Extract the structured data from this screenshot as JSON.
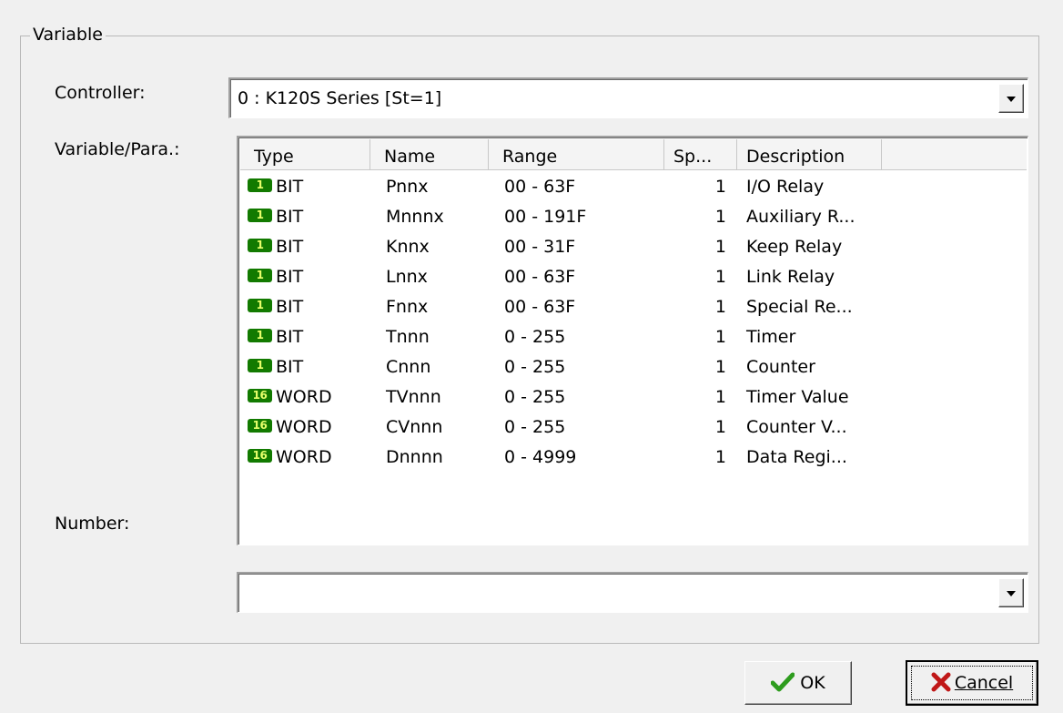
{
  "group": {
    "title": "Variable"
  },
  "labels": {
    "controller": "Controller:",
    "variable_para": "Variable/Para.:",
    "number": "Number:"
  },
  "controller_combo": {
    "value": "0 : K120S Series [St=1]"
  },
  "number_combo": {
    "value": ""
  },
  "table": {
    "columns": [
      "Type",
      "Name",
      "Range",
      "Sp...",
      "Description"
    ],
    "rows": [
      {
        "badge": "1",
        "type": "BIT",
        "name": "Pnnx",
        "range": "00 - 63F",
        "sp": "1",
        "desc": "I/O Relay"
      },
      {
        "badge": "1",
        "type": "BIT",
        "name": "Mnnnx",
        "range": "00 - 191F",
        "sp": "1",
        "desc": "Auxiliary R..."
      },
      {
        "badge": "1",
        "type": "BIT",
        "name": "Knnx",
        "range": "00 - 31F",
        "sp": "1",
        "desc": "Keep Relay"
      },
      {
        "badge": "1",
        "type": "BIT",
        "name": "Lnnx",
        "range": "00 - 63F",
        "sp": "1",
        "desc": "Link Relay"
      },
      {
        "badge": "1",
        "type": "BIT",
        "name": "Fnnx",
        "range": "00 - 63F",
        "sp": "1",
        "desc": "Special Re..."
      },
      {
        "badge": "1",
        "type": "BIT",
        "name": "Tnnn",
        "range": "0 - 255",
        "sp": "1",
        "desc": "Timer"
      },
      {
        "badge": "1",
        "type": "BIT",
        "name": "Cnnn",
        "range": "0 - 255",
        "sp": "1",
        "desc": "Counter"
      },
      {
        "badge": "16",
        "type": "WORD",
        "name": "TVnnn",
        "range": "0 - 255",
        "sp": "1",
        "desc": "Timer Value"
      },
      {
        "badge": "16",
        "type": "WORD",
        "name": "CVnnn",
        "range": "0 - 255",
        "sp": "1",
        "desc": "Counter V..."
      },
      {
        "badge": "16",
        "type": "WORD",
        "name": "Dnnnn",
        "range": "0 - 4999",
        "sp": "1",
        "desc": "Data Regi..."
      }
    ]
  },
  "buttons": {
    "ok": "OK",
    "cancel": "Cancel"
  },
  "icons": {
    "ok": "checkmark-icon",
    "cancel": "x-icon",
    "dropdown": "chevron-down-icon"
  },
  "colors": {
    "badge_bg": "#127a00",
    "badge_fg": "#e8ff6a",
    "check": "#2e9c1e",
    "x": "#c01818"
  }
}
